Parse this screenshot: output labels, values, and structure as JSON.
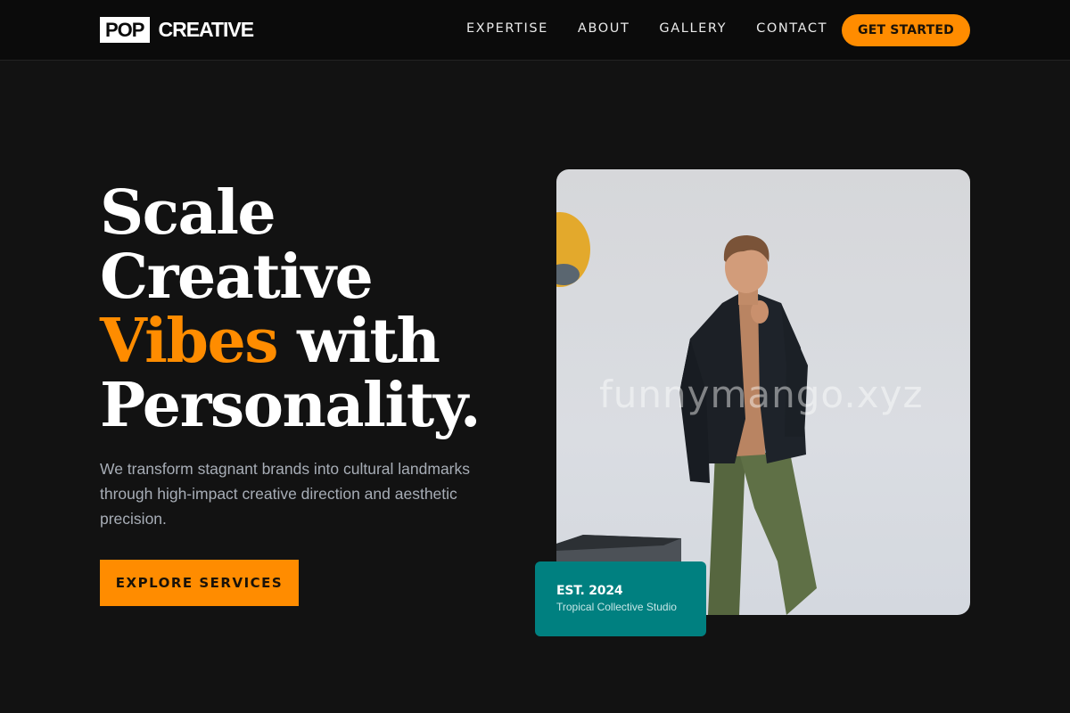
{
  "brand": {
    "logo_box": "POP",
    "logo_text": "CREATIVE"
  },
  "nav": {
    "links": [
      "EXPERTISE",
      "ABOUT",
      "GALLERY",
      "CONTACT"
    ],
    "cta": "GET STARTED"
  },
  "hero": {
    "line1": "Scale",
    "line2": "Creative",
    "accent_word": "Vibes",
    "line3_rest": " with",
    "line4": "Personality.",
    "subtitle": "We transform stagnant brands into cultural landmarks through high-impact creative direction and aesthetic precision.",
    "button": "EXPLORE SERVICES"
  },
  "image": {
    "watermark": "funnymango.xyz"
  },
  "badge": {
    "title": "EST. 2024",
    "subtitle": "Tropical Collective Studio"
  },
  "colors": {
    "accent": "#ff8c00",
    "teal": "#008080",
    "background": "#121212"
  }
}
